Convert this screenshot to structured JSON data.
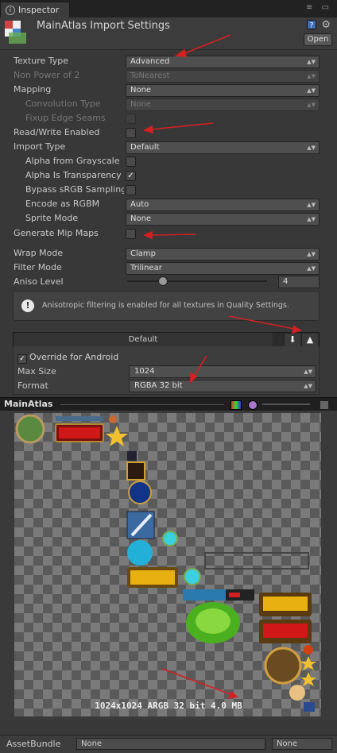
{
  "tab": {
    "label": "Inspector"
  },
  "header": {
    "title": "MainAtlas Import Settings",
    "open_label": "Open"
  },
  "fields": {
    "texture_type": {
      "label": "Texture Type",
      "value": "Advanced"
    },
    "non_power": {
      "label": "Non Power of 2",
      "value": "ToNearest"
    },
    "mapping": {
      "label": "Mapping",
      "value": "None"
    },
    "convolution": {
      "label": "Convolution Type",
      "value": "None"
    },
    "fixup": {
      "label": "Fixup Edge Seams"
    },
    "read_write": {
      "label": "Read/Write Enabled"
    },
    "import_type": {
      "label": "Import Type",
      "value": "Default"
    },
    "alpha_gray": {
      "label": "Alpha from Grayscale"
    },
    "alpha_transp": {
      "label": "Alpha Is Transparency",
      "checked": "✓"
    },
    "bypass": {
      "label": "Bypass sRGB Sampling"
    },
    "encode": {
      "label": "Encode as RGBM",
      "value": "Auto"
    },
    "sprite": {
      "label": "Sprite Mode",
      "value": "None"
    },
    "mipmaps": {
      "label": "Generate Mip Maps"
    },
    "wrap": {
      "label": "Wrap Mode",
      "value": "Clamp"
    },
    "filter": {
      "label": "Filter Mode",
      "value": "Trilinear"
    },
    "aniso": {
      "label": "Aniso Level",
      "value": "4",
      "level_fraction": 0.25
    }
  },
  "help": {
    "text": "Anisotropic filtering is enabled for all textures in Quality Settings.",
    "icon": "exclamation-icon"
  },
  "platform": {
    "default_label": "Default",
    "override_label": "Override for Android",
    "override_check": "✓",
    "max_size": {
      "label": "Max Size",
      "value": "1024"
    },
    "format": {
      "label": "Format",
      "value": "RGBA 32 bit"
    }
  },
  "preview": {
    "title": "MainAtlas",
    "info": "1024x1024  ARGB 32 bit  4.0 MB"
  },
  "assetbundle": {
    "label": "AssetBundle",
    "value1": "None",
    "value2": "None"
  },
  "colors": {
    "annotation_arrow": "#d42020",
    "panel": "#383838"
  }
}
